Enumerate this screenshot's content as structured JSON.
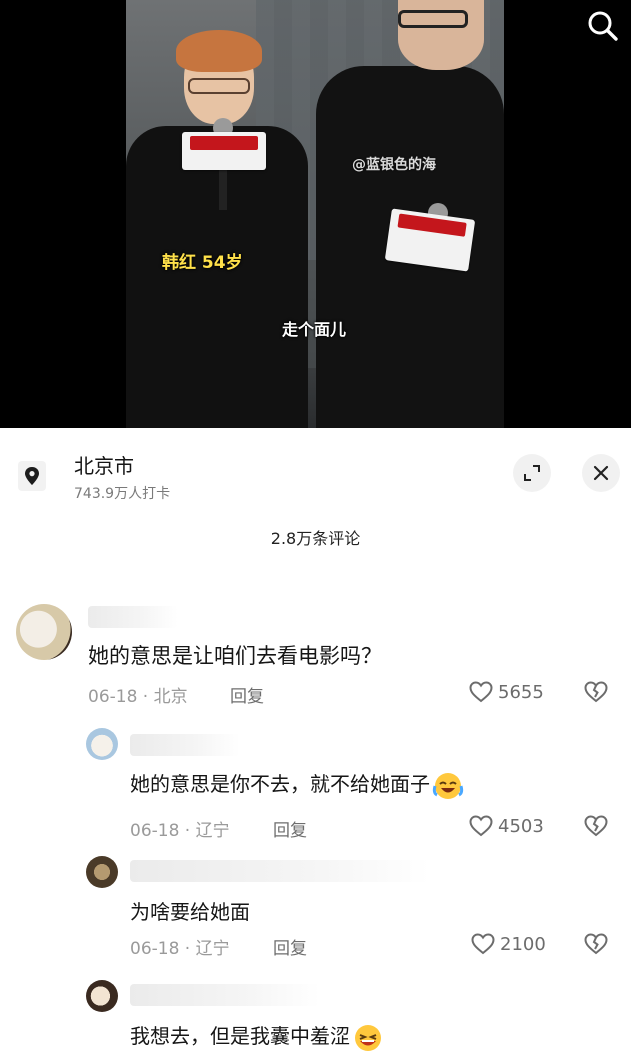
{
  "video": {
    "overlay_name": "韩红 54岁",
    "overlay_caption": "走个面儿",
    "watermark": "@蓝银色的海"
  },
  "location": {
    "name": "北京市",
    "checkins": "743.9万人打卡"
  },
  "comments_count": "2.8万条评论",
  "comments": [
    {
      "text": "她的意思是让咱们去看电影吗？",
      "date": "06-18",
      "region": "北京",
      "reply": "回复",
      "likes": "5655"
    },
    {
      "text": "她的意思是你不去，就不给她面子",
      "date": "06-18",
      "region": "辽宁",
      "reply": "回复",
      "likes": "4503"
    },
    {
      "text": "为啥要给她面",
      "date": "06-18",
      "region": "辽宁",
      "reply": "回复",
      "likes": "2100"
    },
    {
      "text": "我想去，但是我囊中羞涩"
    }
  ],
  "icons": {
    "search": "search-icon",
    "location": "location-pin-icon",
    "expand": "expand-icon",
    "close": "close-icon",
    "like": "heart-icon",
    "dislike": "broken-heart-icon",
    "emoji_laugh": "laugh-cry-emoji",
    "emoji_shy": "grin-sweat-emoji"
  },
  "colors": {
    "overlay_highlight": "#ffe14a",
    "sheet_bg": "#ffffff",
    "meta_gray": "#9a9a9a"
  }
}
